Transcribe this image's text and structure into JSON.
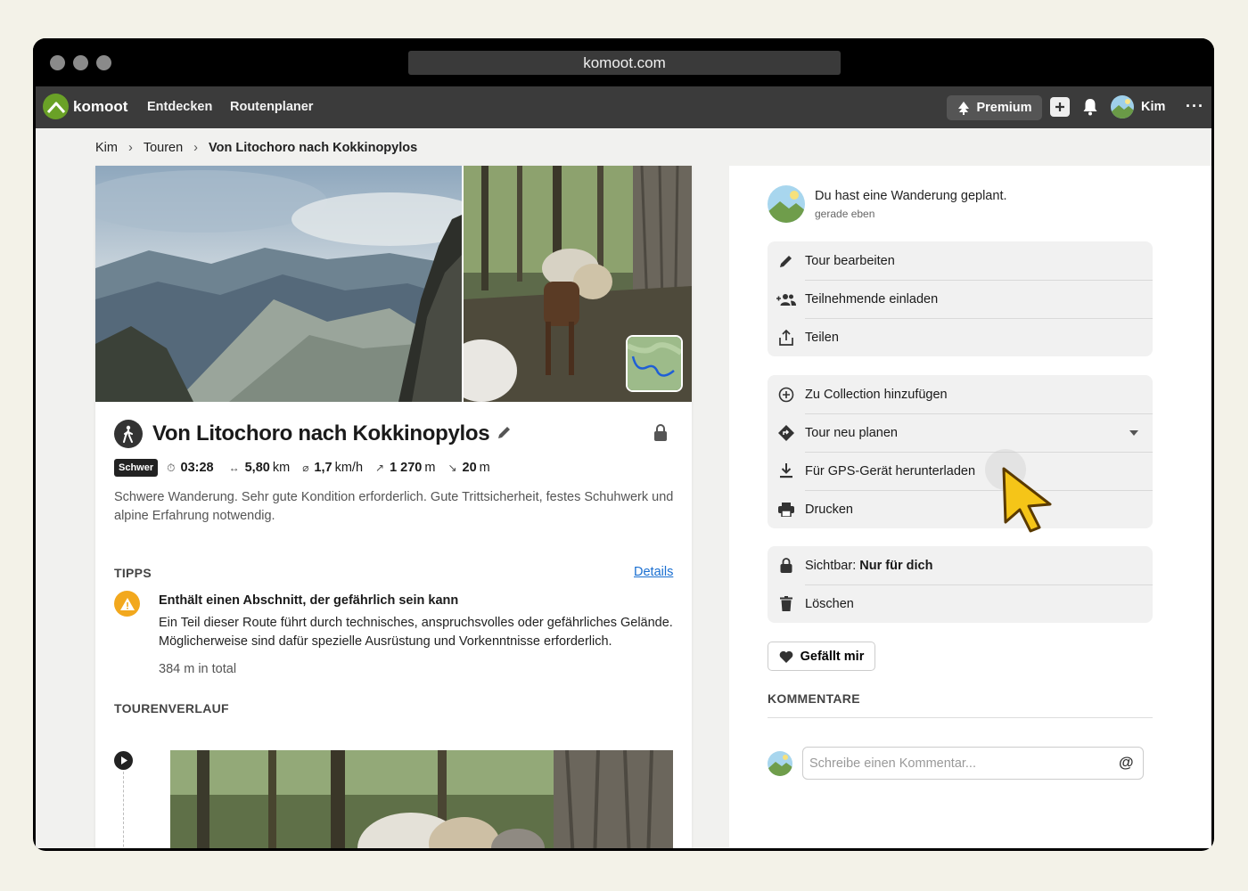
{
  "browser": {
    "url": "komoot.com"
  },
  "nav": {
    "brand": "komoot",
    "links": [
      "Entdecken",
      "Routenplaner"
    ],
    "premium": "Premium",
    "user": "Kim",
    "more": "···"
  },
  "breadcrumb": [
    "Kim",
    "Touren",
    "Von Litochoro nach Kokkinopylos"
  ],
  "tour": {
    "title": "Von Litochoro nach Kokkinopylos",
    "difficulty": "Schwer",
    "duration": "03:28",
    "distance_value": "5,80",
    "distance_unit": "km",
    "speed_value": "1,7",
    "speed_unit": "km/h",
    "up_value": "1 270",
    "up_unit": "m",
    "down_value": "20",
    "down_unit": "m",
    "description": "Schwere Wanderung. Sehr gute Kondition erforderlich. Gute Trittsicherheit, festes Schuhwerk und alpine Erfahrung notwendig."
  },
  "tips": {
    "heading": "TIPPS",
    "details_link": "Details",
    "title": "Enthält einen Abschnitt, der gefährlich sein kann",
    "text": "Ein Teil dieser Route führt durch technisches, anspruchsvolles oder gefährliches Gelände. Möglicherweise sind dafür spezielle Ausrüstung und Vorkenntnisse erforderlich.",
    "meta": "384 m in total"
  },
  "timeline": {
    "heading": "TOURENVERLAUF"
  },
  "activity": {
    "title": "Du hast eine Wanderung geplant.",
    "time": "gerade eben"
  },
  "menu": {
    "group1": [
      "Tour bearbeiten",
      "Teilnehmende einladen",
      "Teilen"
    ],
    "group2": [
      "Zu Collection hinzufügen",
      "Tour neu planen",
      "Für GPS-Gerät herunterladen",
      "Drucken"
    ],
    "visibility_label": "Sichtbar:",
    "visibility_value": "Nur für dich",
    "delete": "Löschen"
  },
  "like_button": "Gefällt mir",
  "comments": {
    "heading": "KOMMENTARE",
    "placeholder": "Schreibe einen Kommentar...",
    "mention": "@"
  },
  "colors": {
    "brand_green": "#6aa127",
    "warning": "#f2a81d",
    "link": "#1a6fd1",
    "cursor": "#f5c518"
  }
}
